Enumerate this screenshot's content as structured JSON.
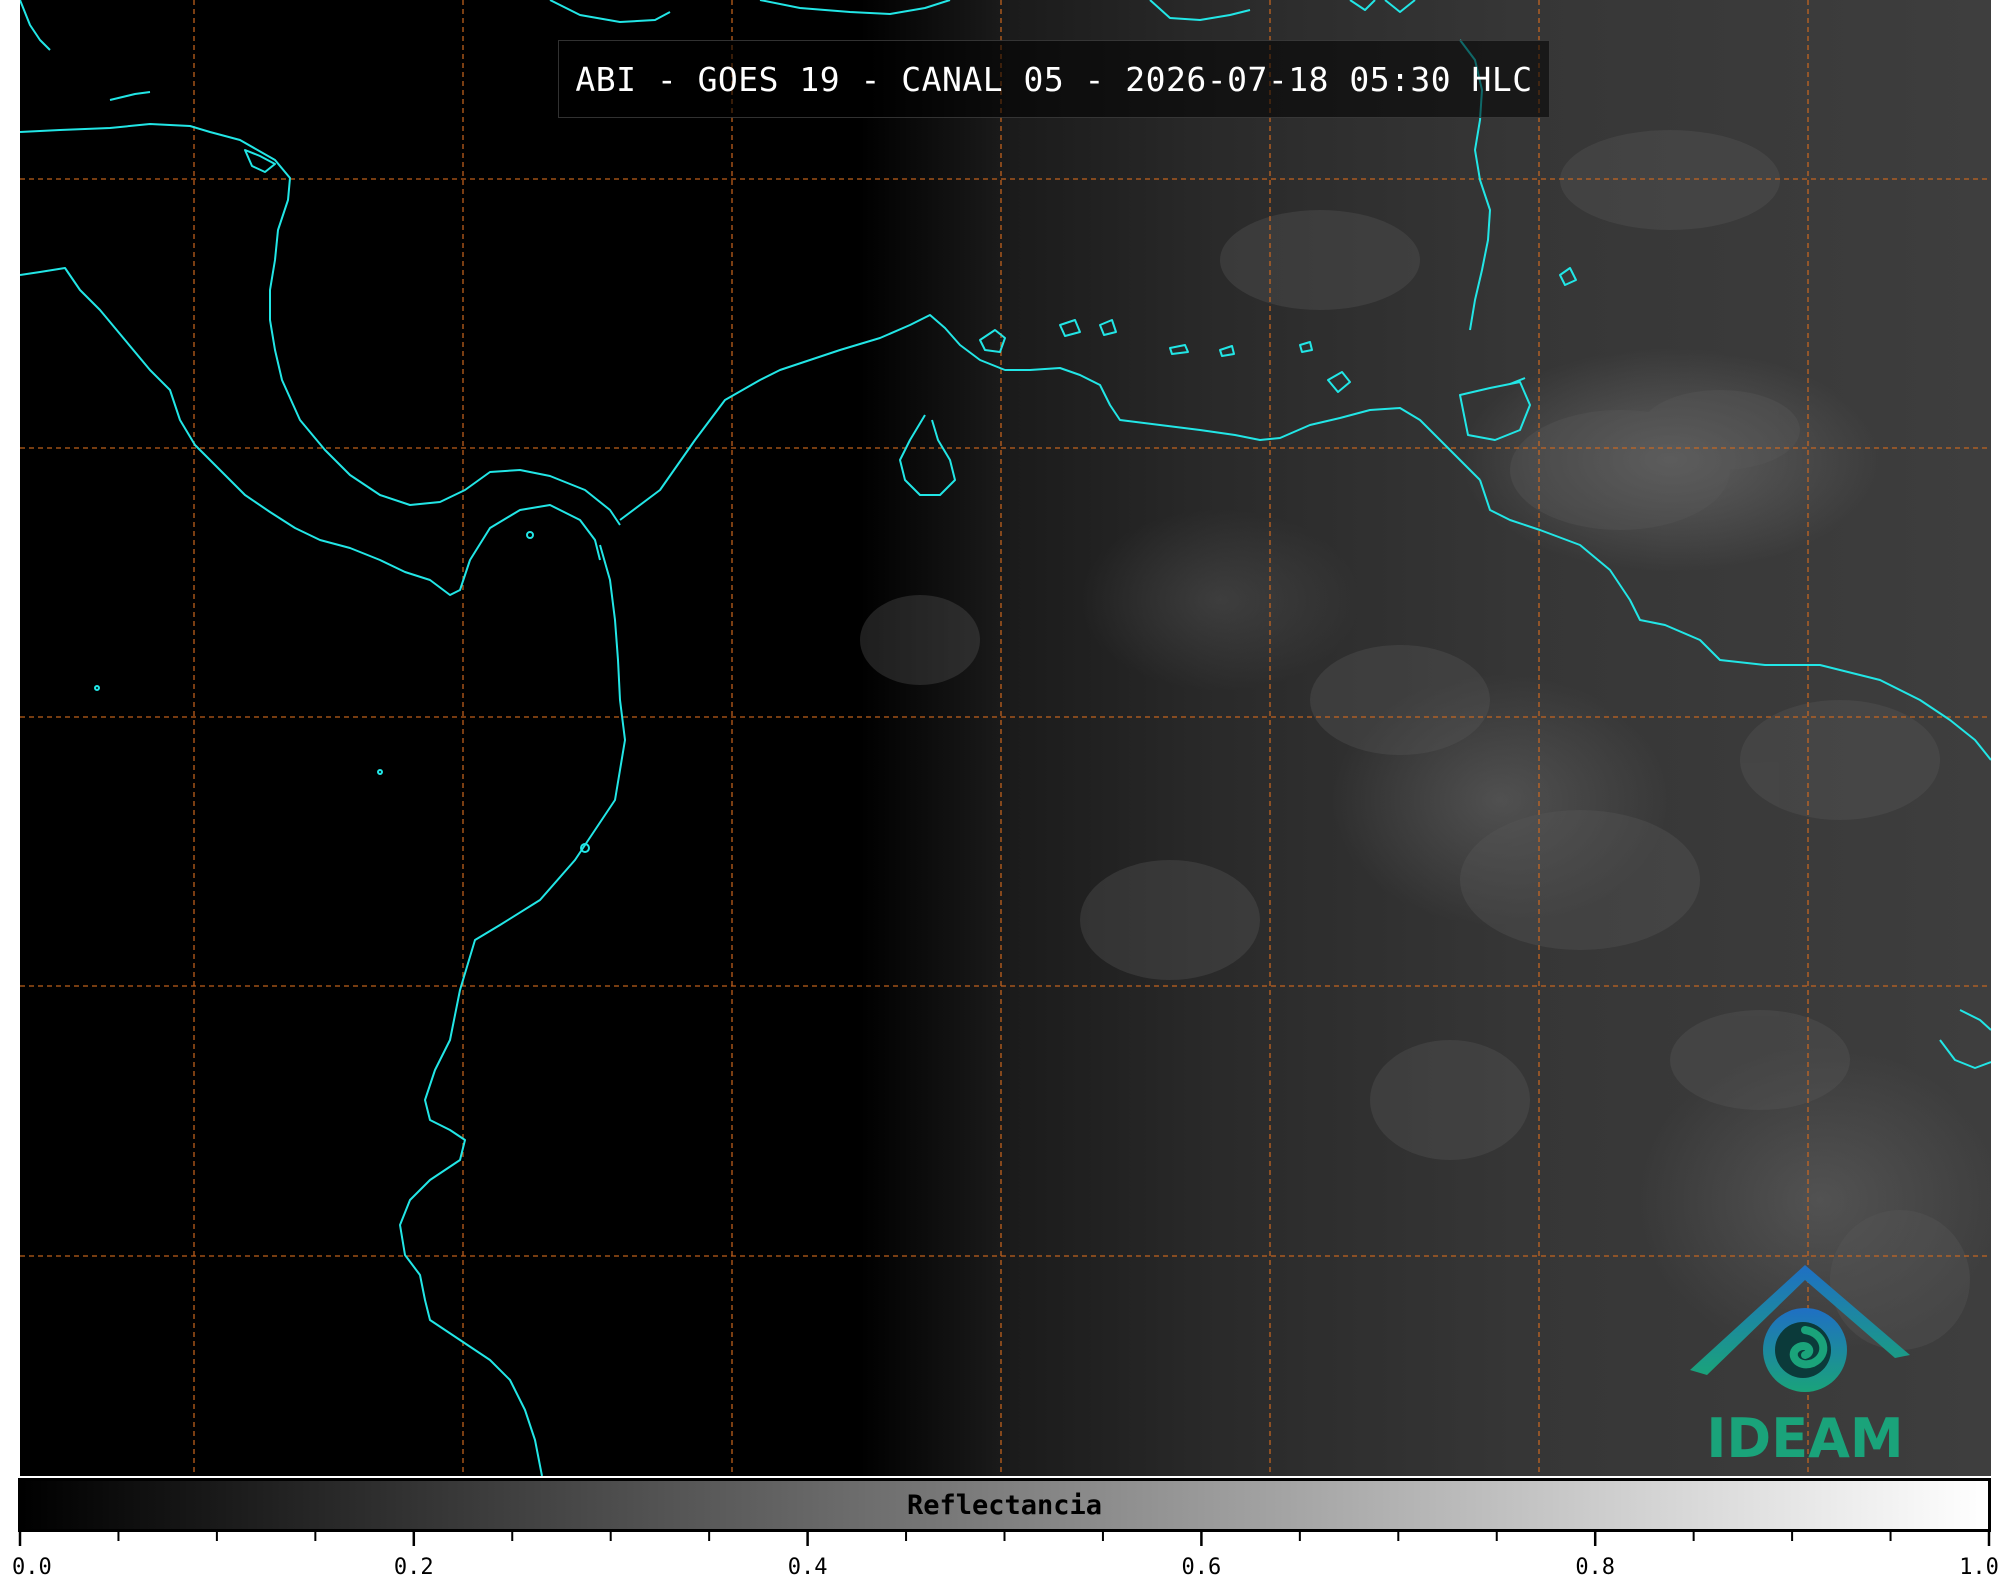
{
  "title": "ABI - GOES 19 - CANAL 05 - 2026-07-18 05:30 HLC",
  "colorbar": {
    "label": "Reflectancia",
    "min": 0.0,
    "max": 1.0,
    "ticks": [
      "0.0",
      "0.2",
      "0.4",
      "0.6",
      "0.8",
      "1.0"
    ]
  },
  "logo": {
    "text": "IDEAM"
  },
  "colors": {
    "coastline": "#22e6e6",
    "gridline": "#d2691e",
    "logo_blue": "#1f6fc4",
    "logo_green": "#1aa37a"
  },
  "gridlines": {
    "style": "dashed"
  }
}
